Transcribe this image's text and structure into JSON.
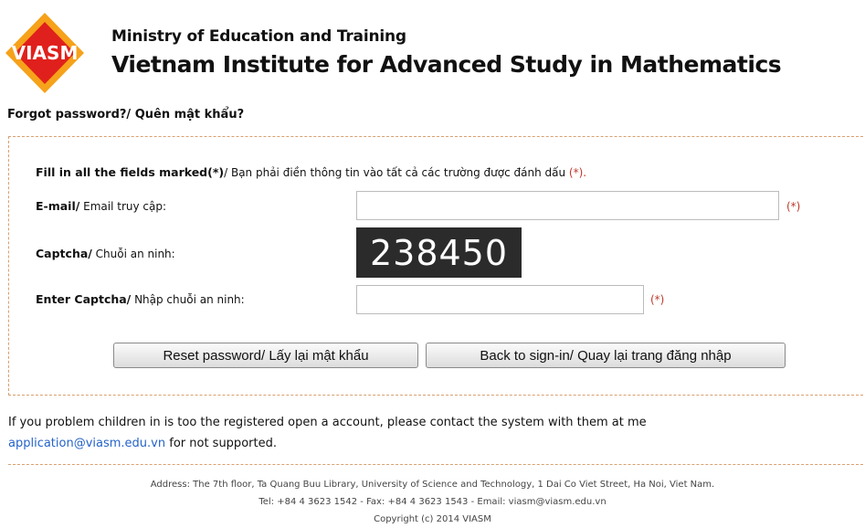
{
  "header": {
    "logo_text": "VIASM",
    "org_line1": "Ministry of Education and Training",
    "org_line2": "Vietnam Institute for Advanced Study in Mathematics"
  },
  "page_title": "Forgot password?/ Quên mật khẩu?",
  "form": {
    "notice_bold": "Fill in all the fields marked(*)",
    "notice_text": "/ Bạn phải điền thông tin vào tất cả các trường được đánh dấu",
    "notice_req": "(*).",
    "email_label_bold": "E-mail/",
    "email_label_text": " Email truy cập:",
    "email_value": "",
    "email_req": "(*)",
    "captcha_label_bold": "Captcha/",
    "captcha_label_text": " Chuỗi an ninh:",
    "captcha_code": "238450",
    "enter_captcha_label_bold": "Enter Captcha/",
    "enter_captcha_label_text": " Nhập chuỗi an ninh:",
    "enter_captcha_value": "",
    "enter_captcha_req": "(*)",
    "reset_button": "Reset password/ Lấy lại mật khẩu",
    "back_button": "Back to sign-in/ Quay lại trang đăng nhập"
  },
  "info": {
    "text1": "If you problem children in is too the registered open a account, please contact the system with them at me",
    "email_link": "application@viasm.edu.vn",
    "text2": " for not supported."
  },
  "footer": {
    "address": "Address: The 7th floor, Ta Quang Buu Library, University of Science and Technology, 1 Dai Co Viet Street, Ha Noi, Viet Nam.",
    "contact": "Tel: +84 4 3623 1542 - Fax: +84 4 3623 1543 - Email: viasm@viasm.edu.vn",
    "copyright": "Copyright (c) 2014 VIASM"
  },
  "colors": {
    "logo_red": "#e0201c",
    "logo_orange": "#f6a21a",
    "required": "#c0392b",
    "link": "#2563c9",
    "dash_border": "#d8a070"
  }
}
